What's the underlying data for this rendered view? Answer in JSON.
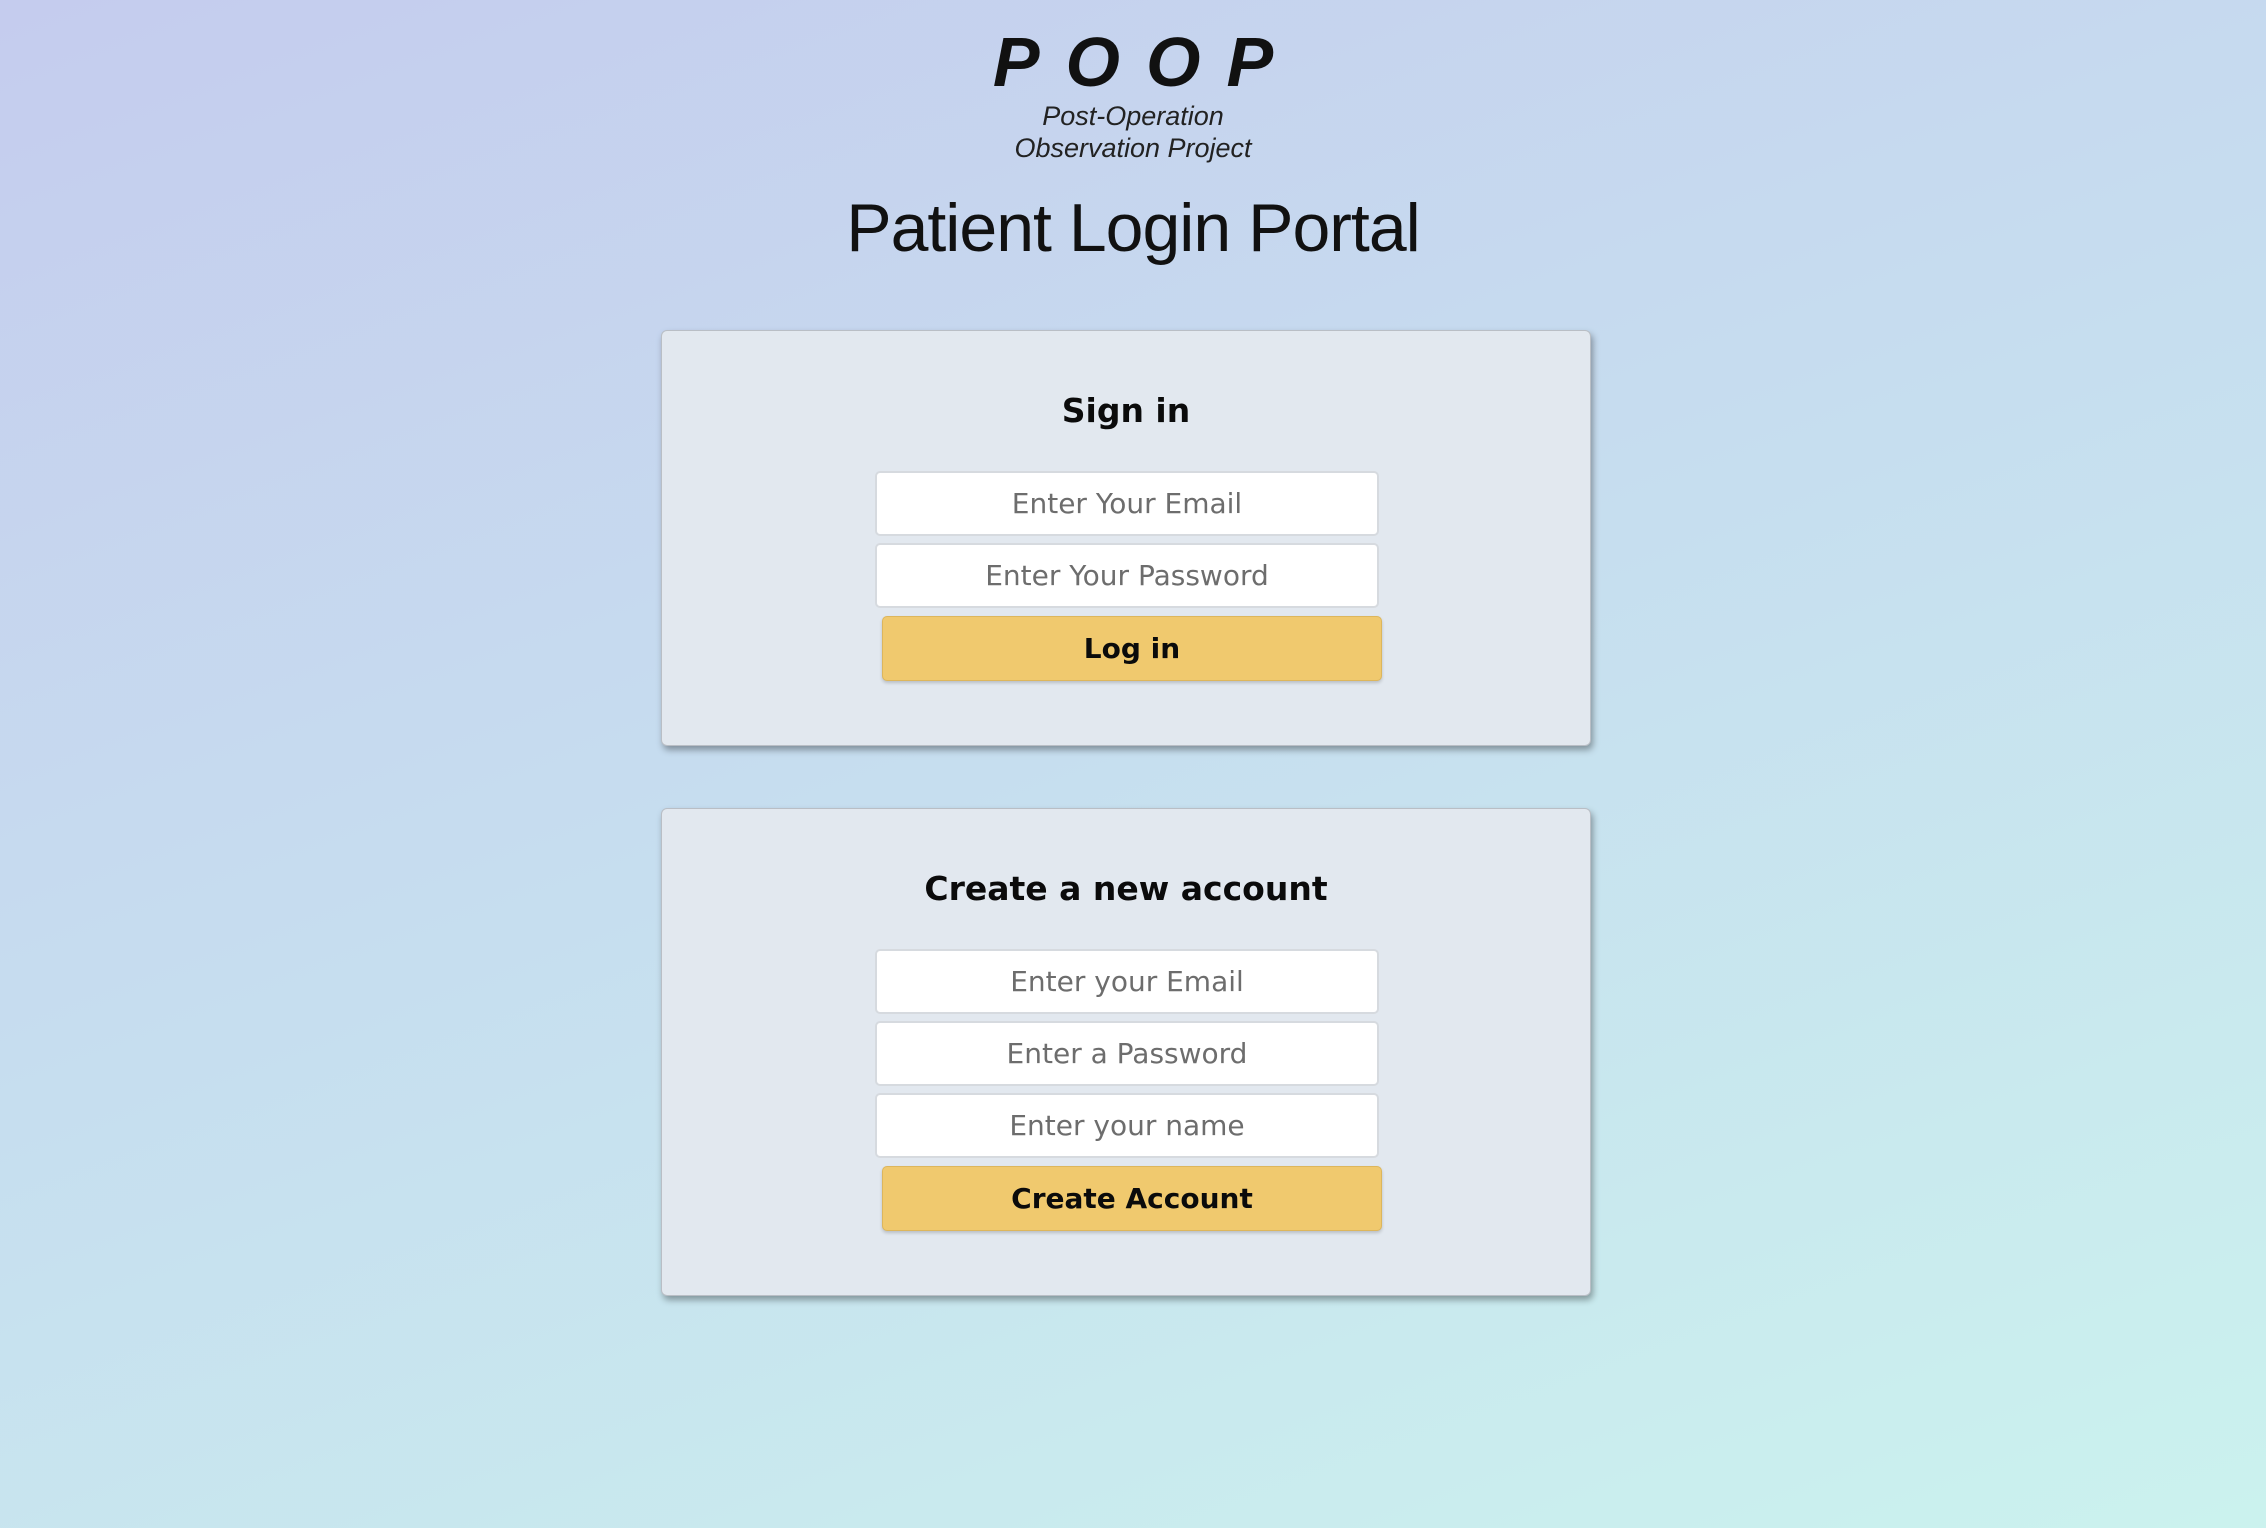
{
  "logo": {
    "word": "POOP",
    "subtitle_line1": "Post-Operation",
    "subtitle_line2": "Observation Project"
  },
  "page_title": "Patient Login Portal",
  "signin": {
    "title": "Sign in",
    "email_placeholder": "Enter Your Email",
    "password_placeholder": "Enter Your Password",
    "submit_label": "Log in"
  },
  "create_account": {
    "title": "Create a new account",
    "email_placeholder": "Enter your Email",
    "password_placeholder": "Enter a Password",
    "name_placeholder": "Enter your name",
    "submit_label": "Create Account"
  },
  "colors": {
    "button": "#f0c96e",
    "card": "#e2e8ef",
    "background_start": "#c5ccee",
    "background_end": "#cbf2ee"
  }
}
